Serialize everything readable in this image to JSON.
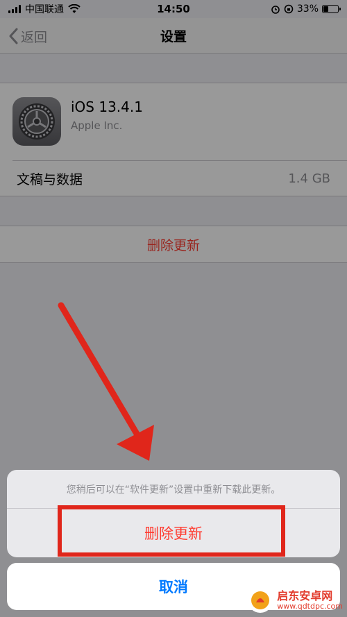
{
  "status_bar": {
    "carrier": "中国联通",
    "time": "14:50",
    "battery": "33%",
    "battery_level": 0.33
  },
  "nav": {
    "back_label": "返回",
    "title": "设置"
  },
  "update": {
    "name": "iOS 13.4.1",
    "vendor": "Apple Inc.",
    "docs_label": "文稿与数据",
    "docs_value": "1.4 GB",
    "delete_label": "删除更新"
  },
  "action_sheet": {
    "message": "您稍后可以在“软件更新”设置中重新下载此更新。",
    "delete_label": "删除更新",
    "cancel_label": "取消"
  },
  "watermark": {
    "name": "启东安卓网",
    "url": "www.qdtdpc.com"
  },
  "colors": {
    "accent": "#007aff",
    "destructive": "#ff3b30",
    "annotation": "#e0261b"
  },
  "icons": [
    "chevron-left-icon",
    "gear-icon",
    "wifi-icon",
    "alarm-icon",
    "orientation-lock-icon",
    "battery-icon",
    "signal-icon"
  ]
}
